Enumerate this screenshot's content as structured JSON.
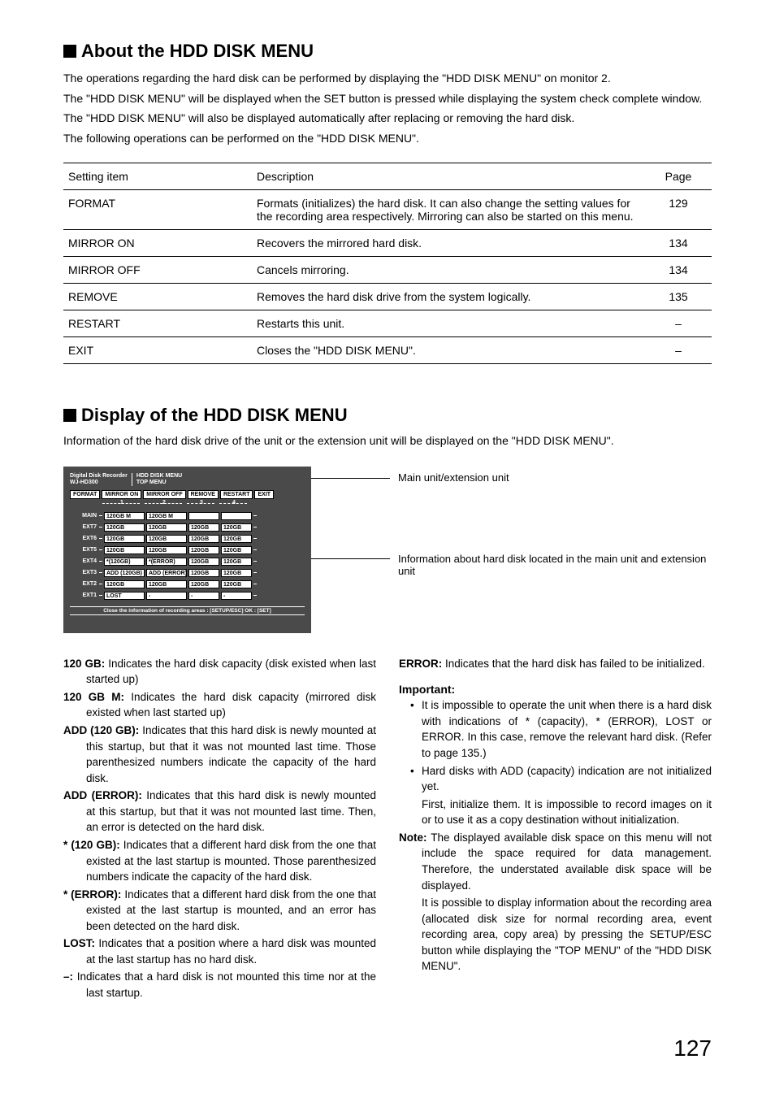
{
  "pageNumber": "127",
  "section1": {
    "title": "About the HDD DISK MENU",
    "intro": [
      "The operations regarding the hard disk can be performed by displaying the \"HDD DISK MENU\" on monitor 2.",
      "The \"HDD DISK MENU\" will be displayed when the SET button is pressed while displaying the system check complete window.",
      "The \"HDD DISK MENU\" will also be displayed automatically after replacing or removing the hard disk."
    ],
    "introFollow": "The following operations can be performed on the \"HDD DISK MENU\".",
    "headers": {
      "c1": "Setting item",
      "c2": "Description",
      "c3": "Page"
    },
    "rows": [
      {
        "item": "FORMAT",
        "desc": "Formats (initializes) the hard disk. It can also change the setting values for the recording area respectively. Mirroring can also be started on this menu.",
        "page": "129"
      },
      {
        "item": "MIRROR ON",
        "desc": "Recovers the mirrored hard disk.",
        "page": "134"
      },
      {
        "item": "MIRROR OFF",
        "desc": "Cancels mirroring.",
        "page": "134"
      },
      {
        "item": "REMOVE",
        "desc": "Removes the hard disk drive from the system logically.",
        "page": "135"
      },
      {
        "item": "RESTART",
        "desc": "Restarts this unit.",
        "page": "–"
      },
      {
        "item": "EXIT",
        "desc": "Closes the \"HDD DISK MENU\".",
        "page": "–"
      }
    ]
  },
  "section2": {
    "title": "Display of the HDD DISK MENU",
    "intro": "Information of the hard disk drive of the unit or the extension unit will be displayed on the \"HDD DISK MENU\".",
    "anno1": "Main unit/extension unit",
    "anno2": "Information about hard disk located in the main unit and extension unit"
  },
  "screen": {
    "headerLeft1": "Digital Disk Recorder",
    "headerLeft2": "WJ-HD300",
    "headerRight1": "HDD DISK MENU",
    "headerRight2": "TOP MENU",
    "tabs": [
      "FORMAT",
      "MIRROR ON",
      "MIRROR OFF",
      "REMOVE",
      "RESTART",
      "EXIT"
    ],
    "cols": [
      "1",
      "2",
      "3",
      "4"
    ],
    "rows": [
      {
        "lbl": "MAIN",
        "c": [
          "120GB M",
          "120GB M",
          "",
          ""
        ]
      },
      {
        "lbl": "EXT7",
        "c": [
          "120GB",
          "120GB",
          "120GB",
          "120GB"
        ]
      },
      {
        "lbl": "EXT6",
        "c": [
          "120GB",
          "120GB",
          "120GB",
          "120GB"
        ]
      },
      {
        "lbl": "EXT5",
        "c": [
          "120GB",
          "120GB",
          "120GB",
          "120GB"
        ]
      },
      {
        "lbl": "EXT4",
        "c": [
          "*(120GB)",
          "*(ERROR)",
          "120GB",
          "120GB"
        ]
      },
      {
        "lbl": "EXT3",
        "c": [
          "ADD (120GB)",
          "ADD (ERROR)",
          "120GB",
          "120GB"
        ]
      },
      {
        "lbl": "EXT2",
        "c": [
          "120GB",
          "120GB",
          "120GB",
          "120GB"
        ]
      },
      {
        "lbl": "EXT1",
        "c": [
          "LOST",
          "-",
          "-",
          "-"
        ]
      }
    ],
    "footer": "Close the information of recording areas : [SETUP/ESC] OK : [SET]"
  },
  "defsLeft": [
    {
      "term": "120 GB:",
      "text": " Indicates the hard disk capacity (disk existed when last started up)"
    },
    {
      "term": "120 GB M:",
      "text": " Indicates the hard disk capacity (mirrored disk existed when last started up)"
    },
    {
      "term": "ADD (120 GB):",
      "text": " Indicates that this hard disk is newly mounted at this startup, but that it was not mounted last time. Those parenthesized numbers indicate the capacity of the hard disk."
    },
    {
      "term": "ADD (ERROR):",
      "text": " Indicates that this hard disk is newly mounted at this startup, but that it was not mounted last time. Then, an error is detected on the hard disk."
    },
    {
      "term": "* (120 GB):",
      "text": " Indicates that a different hard disk from the one that existed at the last startup is mounted. Those parenthesized numbers indicate the capacity of the hard disk."
    },
    {
      "term": "* (ERROR):",
      "text": " Indicates that a different hard disk from the one that existed at the last startup is mounted, and an error has been detected on the hard disk."
    },
    {
      "term": "LOST:",
      "text": " Indicates that a position where a hard disk was mounted at the last startup has no hard disk."
    },
    {
      "term": "–:",
      "text": " Indicates that a hard disk is not mounted this time nor at the last startup."
    }
  ],
  "defsRightTop": {
    "term": "ERROR:",
    "text": " Indicates that the hard disk has failed to be initialized."
  },
  "important": {
    "header": "Important:",
    "items": [
      "It is impossible to operate the unit when there is a hard disk with indications of * (capacity), * (ERROR), LOST or ERROR. In this case, remove the relevant hard disk. (Refer to page 135.)",
      "Hard disks with ADD (capacity) indication are not initialized yet."
    ],
    "cont": "First, initialize them. It is impossible to record images on it or to use it as a copy destination without initialization."
  },
  "note": {
    "term": "Note:",
    "text": " The displayed available disk space on this menu will not include the space required for data management. Therefore, the understated available disk space will be displayed.",
    "cont": "It is possible to display information about the recording area (allocated disk size for normal recording area, event recording area, copy area) by pressing the SETUP/ESC button while displaying the \"TOP MENU\" of the \"HDD DISK MENU\"."
  }
}
